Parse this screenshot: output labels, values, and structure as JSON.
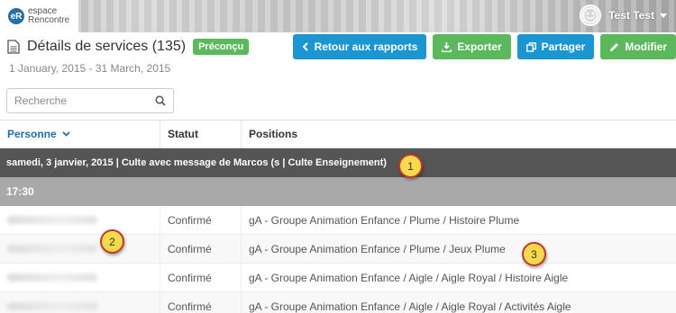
{
  "header": {
    "logo_badge": "eR",
    "logo_line1": "espace",
    "logo_line2": "Rencontre",
    "user_name": "Test Test"
  },
  "page": {
    "title": "Détails de services (135)",
    "badge": "Préconçu",
    "date_range": "1 January, 2015 - 31 March, 2015"
  },
  "actions": {
    "back": "Retour aux rapports",
    "export": "Exporter",
    "share": "Partager",
    "edit": "Modifier"
  },
  "search": {
    "placeholder": "Recherche"
  },
  "table": {
    "headers": {
      "person": "Personne",
      "status": "Statut",
      "positions": "Positions"
    },
    "group": "samedi, 3 janvier, 2015 | Culte avec message de Marcos (s | Culte Enseignement)",
    "time": "17:30",
    "rows": [
      {
        "status": "Confirmé",
        "position": "gA - Groupe Animation Enfance / Plume / Histoire Plume"
      },
      {
        "status": "Confirmé",
        "position": "gA - Groupe Animation Enfance / Plume / Jeux Plume"
      },
      {
        "status": "Confirmé",
        "position": "gA - Groupe Animation Enfance / Aigle / Aigle Royal / Histoire Aigle"
      },
      {
        "status": "Confirmé",
        "position": "gA - Groupe Animation Enfance / Aigle / Aigle Royal / Activités Aigle"
      }
    ]
  },
  "callouts": [
    "1",
    "2",
    "3"
  ],
  "colors": {
    "primary": "#1b96d1",
    "success": "#5cb85c",
    "group_row": "#555555",
    "time_row": "#a9a9a9"
  }
}
